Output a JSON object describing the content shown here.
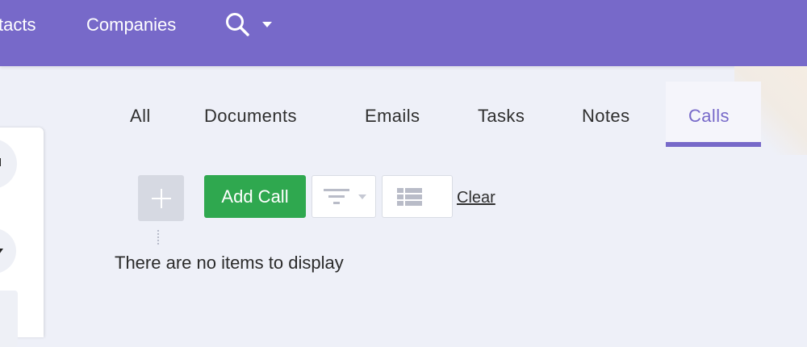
{
  "topnav": {
    "items": [
      {
        "label": "tacts"
      },
      {
        "label": "Companies"
      }
    ],
    "search_icon": "search-icon",
    "dropdown_icon": "chevron-down-icon"
  },
  "tabs": [
    {
      "label": "All"
    },
    {
      "label": "Documents"
    },
    {
      "label": "Emails"
    },
    {
      "label": "Tasks"
    },
    {
      "label": "Notes"
    },
    {
      "label": "Calls",
      "active": true
    }
  ],
  "toolbar": {
    "add_icon": "plus-icon",
    "add_call_label": "Add Call",
    "filter_icon": "filter-icon",
    "view_icon": "list-view-icon",
    "clear_label": "Clear"
  },
  "content": {
    "empty_message": "There are no items to display"
  },
  "colors": {
    "accent": "#7769c9",
    "success": "#2fa84f",
    "background": "#eef0f8"
  }
}
